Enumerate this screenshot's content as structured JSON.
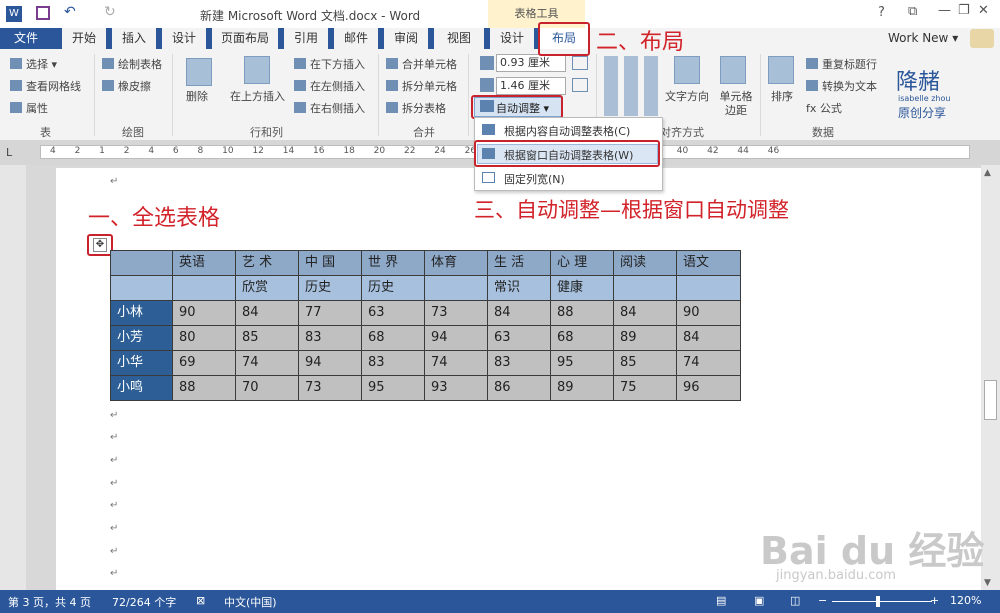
{
  "window": {
    "title": "新建 Microsoft Word 文档.docx - Word",
    "context_tab_group": "表格工具",
    "help": "?",
    "account": "Work New ▾"
  },
  "tabs": [
    "文件",
    "开始",
    "插入",
    "设计",
    "页面布局",
    "引用",
    "邮件",
    "审阅",
    "视图",
    "设计",
    "布局"
  ],
  "ribbon": {
    "table_group": {
      "items": [
        "选择 ▾",
        "查看网格线",
        "属性"
      ],
      "label": "表"
    },
    "draw_group": {
      "items": [
        "绘制表格",
        "橡皮擦"
      ],
      "label": "绘图"
    },
    "rows_cols": {
      "delete": "删除",
      "insert_above": "在上方插入",
      "insert_below": "在下方插入",
      "insert_left": "在左侧插入",
      "insert_right": "在右侧插入",
      "label": "行和列"
    },
    "merge": {
      "items": [
        "合并单元格",
        "拆分单元格",
        "拆分表格"
      ],
      "label": "合并"
    },
    "cell_size": {
      "height": "0.93 厘米",
      "width": "1.46 厘米",
      "autofit": "自动调整 ▾"
    },
    "align": {
      "text_direction": "文字方向",
      "cell_margins": "单元格边距",
      "label": "对齐方式"
    },
    "data": {
      "sort": "排序",
      "repeat_header": "重复标题行",
      "convert": "转换为文本",
      "formula": "fx 公式",
      "label": "数据"
    },
    "brand": {
      "line1": "降赭",
      "line2": "isabelle zhou",
      "line3": "原创分享"
    }
  },
  "autofit_menu": [
    "根据内容自动调整表格(C)",
    "根据窗口自动调整表格(W)",
    "固定列宽(N)"
  ],
  "ruler": "4 2 1 2 4 6 8 10 12 14 16 18 20 22 24 26 28 30 32 34 36 38 40 42 44 46",
  "annotations": {
    "step1": "一、全选表格",
    "step2": "二、布局",
    "step3": "三、自动调整—根据窗口自动调整"
  },
  "table": {
    "header1": [
      "",
      "英语",
      "艺 术",
      "中 国",
      "世 界",
      "体育",
      "生 活",
      "心 理",
      "阅读",
      "语文"
    ],
    "header2": [
      "",
      "",
      "欣赏",
      "历史",
      "历史",
      "",
      "常识",
      "健康",
      "",
      ""
    ],
    "rows": [
      [
        "小林",
        "90",
        "84",
        "77",
        "63",
        "73",
        "84",
        "88",
        "84",
        "90"
      ],
      [
        "小芳",
        "80",
        "85",
        "83",
        "68",
        "94",
        "63",
        "68",
        "89",
        "84"
      ],
      [
        "小华",
        "69",
        "74",
        "94",
        "83",
        "74",
        "83",
        "95",
        "85",
        "74"
      ],
      [
        "小鸣",
        "88",
        "70",
        "73",
        "95",
        "93",
        "86",
        "89",
        "75",
        "96"
      ]
    ]
  },
  "status": {
    "page": "第 3 页，共 4 页",
    "words": "72/264 个字",
    "lang": "中文(中国)",
    "zoom": "120%"
  },
  "watermark": {
    "main": "Bai du 经验",
    "sub": "jingyan.baidu.com"
  },
  "colors": {
    "tab_blue": "#2b579a",
    "annotation_red": "#d2232a",
    "table_header": "#8ea9c8",
    "name_col": "#2d5f96"
  }
}
